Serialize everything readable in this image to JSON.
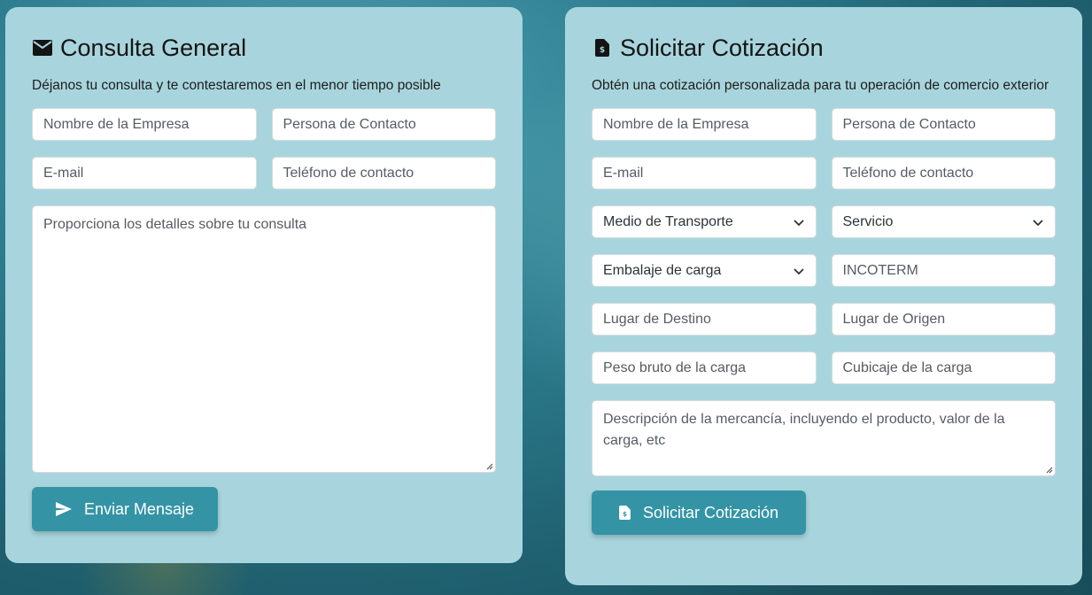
{
  "consulta": {
    "title": "Consulta General",
    "subtitle": "Déjanos tu consulta y te contestaremos en el menor tiempo posible",
    "company_placeholder": "Nombre de la Empresa",
    "contact_placeholder": "Persona de Contacto",
    "email_placeholder": "E-mail",
    "phone_placeholder": "Teléfono de contacto",
    "details_placeholder": "Proporciona los detalles sobre tu consulta",
    "submit_label": "Enviar Mensaje"
  },
  "cotizacion": {
    "title": "Solicitar Cotización",
    "subtitle": "Obtén una cotización personalizada para tu operación de comercio exterior",
    "company_placeholder": "Nombre de la Empresa",
    "contact_placeholder": "Persona de Contacto",
    "email_placeholder": "E-mail",
    "phone_placeholder": "Teléfono de contacto",
    "transport_value": "Medio de Transporte",
    "service_value": "Servicio",
    "packing_value": "Embalaje de carga",
    "incoterm_placeholder": "INCOTERM",
    "destination_placeholder": "Lugar de Destino",
    "origin_placeholder": "Lugar de Origen",
    "weight_placeholder": "Peso bruto de la carga",
    "volume_placeholder": "Cubicaje de la carga",
    "description_placeholder": "Descripción de la mercancía, incluyendo el producto, valor de la carga, etc",
    "submit_label": "Solicitar Cotización"
  }
}
